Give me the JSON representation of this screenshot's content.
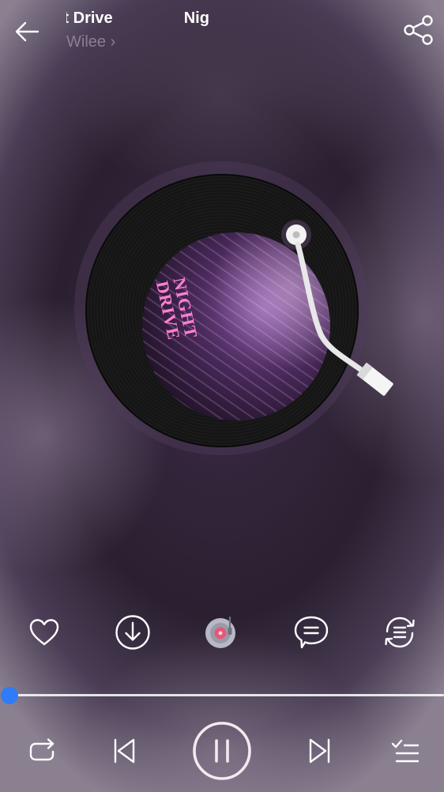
{
  "header": {
    "title_part": "ght Drive",
    "title_repeat": "Nig",
    "artist": "Wilee",
    "artist_chevron": "›",
    "back_icon": "arrow-left-icon",
    "share_icon": "share-icon"
  },
  "cover": {
    "text": "NIGHT DRIVE"
  },
  "actions": [
    {
      "name": "like",
      "icon": "heart-icon"
    },
    {
      "name": "download",
      "icon": "download-icon"
    },
    {
      "name": "turntable-mode",
      "icon": "vinyl-icon"
    },
    {
      "name": "comments",
      "icon": "comment-icon"
    },
    {
      "name": "playback-mode",
      "icon": "loop-icon"
    }
  ],
  "progress": {
    "value": 0
  },
  "controls": [
    {
      "name": "repeat",
      "icon": "repeat-icon"
    },
    {
      "name": "previous",
      "icon": "previous-icon"
    },
    {
      "name": "play-pause",
      "icon": "pause-icon"
    },
    {
      "name": "next",
      "icon": "next-icon"
    },
    {
      "name": "playlist",
      "icon": "playlist-icon"
    }
  ],
  "colors": {
    "accent": "#2f7cf6",
    "icon": "#ffffff",
    "vinyl_button": "#e05a78"
  }
}
